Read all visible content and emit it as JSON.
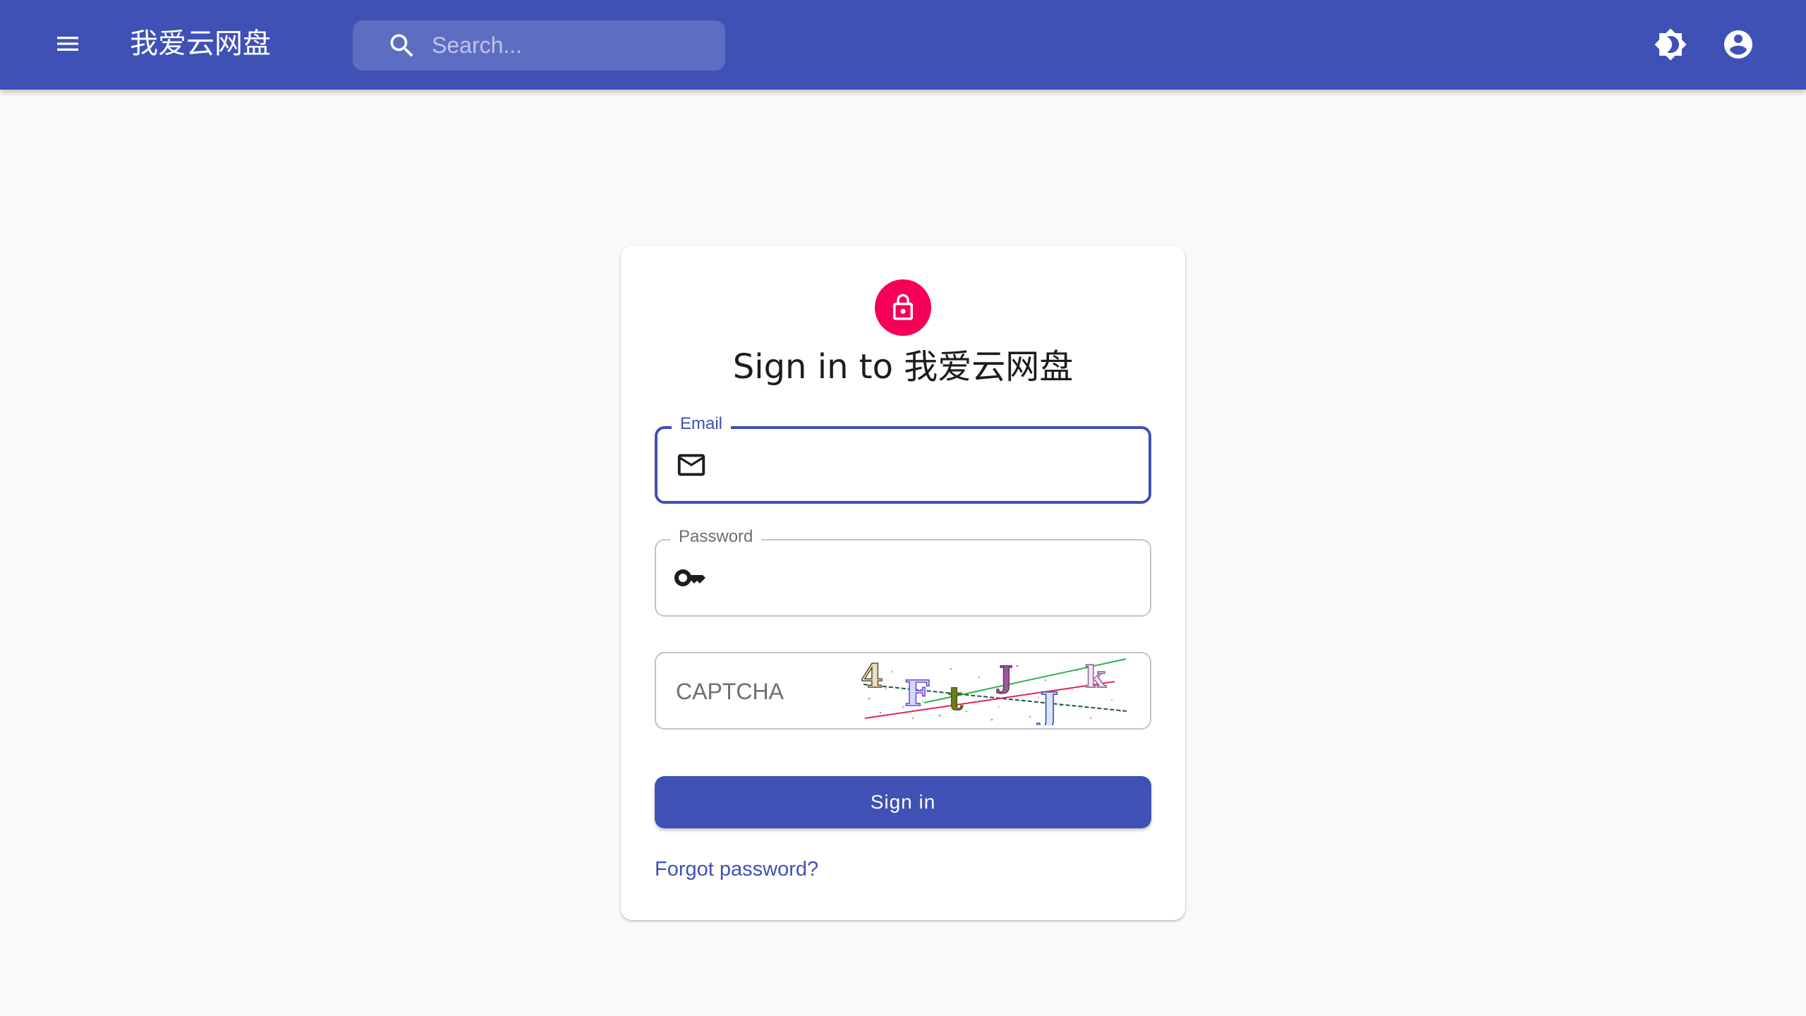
{
  "header": {
    "app_title": "我爱云网盘",
    "search_placeholder": "Search...",
    "menu_icon": "menu-icon",
    "theme_icon": "brightness-icon",
    "account_icon": "account-circle-icon",
    "brand_color": "#3f51b5"
  },
  "login": {
    "title": "Sign in to 我爱云网盘",
    "lock_icon": "lock-icon",
    "avatar_color": "#f50057",
    "email_label": "Email",
    "email_value": "",
    "password_label": "Password",
    "password_value": "",
    "captcha_placeholder": "CAPTCHA",
    "captcha_text": "4FtJJk",
    "signin_label": "Sign in",
    "forgot_label": "Forgot password?"
  }
}
